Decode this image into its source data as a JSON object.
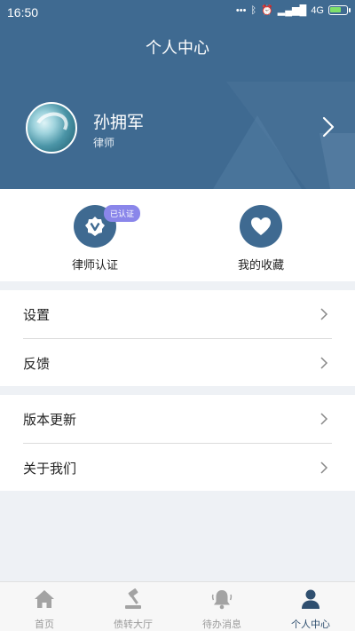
{
  "status_bar": {
    "time": "16:50",
    "network": "4G"
  },
  "header": {
    "title": "个人中心"
  },
  "profile": {
    "name": "孙拥军",
    "role": "律师"
  },
  "quick_actions": [
    {
      "label": "律师认证",
      "icon": "verified-v-icon",
      "badge": "已认证"
    },
    {
      "label": "我的收藏",
      "icon": "heart-icon"
    }
  ],
  "menu_groups": [
    {
      "items": [
        {
          "label": "设置"
        },
        {
          "label": "反馈"
        }
      ]
    },
    {
      "items": [
        {
          "label": "版本更新"
        },
        {
          "label": "关于我们"
        }
      ]
    }
  ],
  "tabbar": {
    "tabs": [
      {
        "label": "首页",
        "icon": "home-icon",
        "active": false
      },
      {
        "label": "债转大厅",
        "icon": "gavel-icon",
        "active": false
      },
      {
        "label": "待办消息",
        "icon": "bell-icon",
        "active": false
      },
      {
        "label": "个人中心",
        "icon": "person-icon",
        "active": true
      }
    ]
  },
  "colors": {
    "primary": "#3f6a91",
    "badge": "#8a86ea",
    "active_tab": "#2f4f6f",
    "inactive_tab": "#9a9a9a"
  }
}
